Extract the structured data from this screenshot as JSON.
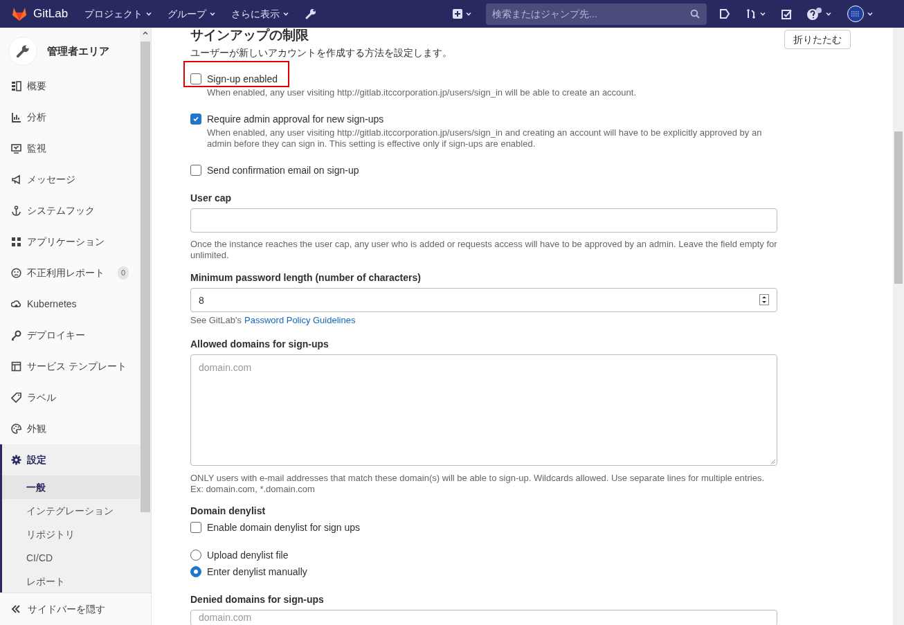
{
  "top_bar": {
    "brand": "GitLab",
    "menus": [
      {
        "label": "プロジェクト"
      },
      {
        "label": "グループ"
      },
      {
        "label": "さらに表示"
      }
    ],
    "search": {
      "placeholder": "検索またはジャンプ先..."
    }
  },
  "sidebar": {
    "title": "管理者エリア",
    "items": [
      {
        "label": "概要",
        "selected": false
      },
      {
        "label": "分析",
        "selected": false
      },
      {
        "label": "監視",
        "selected": false
      },
      {
        "label": "メッセージ",
        "selected": false
      },
      {
        "label": "システムフック",
        "selected": false
      },
      {
        "label": "アプリケーション",
        "selected": false
      },
      {
        "label": "不正利用レポート",
        "selected": false,
        "badge": "0"
      },
      {
        "label": "Kubernetes",
        "selected": false
      },
      {
        "label": "デプロイキー",
        "selected": false
      },
      {
        "label": "サービス テンプレート",
        "selected": false
      },
      {
        "label": "ラベル",
        "selected": false
      },
      {
        "label": "外観",
        "selected": false
      },
      {
        "label": "設定",
        "selected": true,
        "children": [
          {
            "label": "一般",
            "selected": true
          },
          {
            "label": "インテグレーション",
            "selected": false
          },
          {
            "label": "リポジトリ",
            "selected": false
          },
          {
            "label": "CI/CD",
            "selected": false
          },
          {
            "label": "レポート",
            "selected": false
          }
        ]
      }
    ],
    "collapse": "サイドバーを隠す"
  },
  "section": {
    "title": "サインアップの制限",
    "collapse_button": "折りたたむ",
    "description": "ユーザーが新しいアカウントを作成する方法を設定します。"
  },
  "fields": [
    {
      "kind": "checkbox",
      "label": "Sign-up enabled",
      "checked": false,
      "highlighted": true,
      "help": "When enabled, any user visiting http://gitlab.itccorporation.jp/users/sign_in will be able to create an account."
    },
    {
      "kind": "checkbox",
      "label": "Require admin approval for new sign-ups",
      "checked": true,
      "help": "When enabled, any user visiting http://gitlab.itccorporation.jp/users/sign_in and creating an account will have to be explicitly approved by an admin before they can sign in. This setting is effective only if sign-ups are enabled."
    },
    {
      "kind": "checkbox",
      "label": "Send confirmation email on sign-up",
      "checked": false
    },
    {
      "kind": "input",
      "label": "User cap",
      "help": "Once the instance reaches the user cap, any user who is added or requests access will have to be approved by an admin. Leave the field empty for unlimited."
    },
    {
      "kind": "number",
      "label": "Minimum password length (number of characters)",
      "value": "8",
      "help": "See GitLab's",
      "help_link": "Password Policy Guidelines"
    },
    {
      "kind": "textarea",
      "label": "Allowed domains for sign-ups",
      "placeholder": "domain.com",
      "help": "ONLY users with e-mail addresses that match these domain(s) will be able to sign-up. Wildcards allowed. Use separate lines for multiple entries. Ex: domain.com, *.domain.com"
    },
    {
      "kind": "heading",
      "label": "Domain denylist"
    },
    {
      "kind": "checkbox",
      "label": "Enable domain denylist for sign ups",
      "checked": false
    },
    {
      "kind": "radio",
      "label": "Upload denylist file",
      "selected": false
    },
    {
      "kind": "radio",
      "label": "Enter denylist manually",
      "selected": true
    },
    {
      "kind": "textarea_cut",
      "label": "Denied domains for sign-ups",
      "placeholder": "domain.com"
    }
  ]
}
